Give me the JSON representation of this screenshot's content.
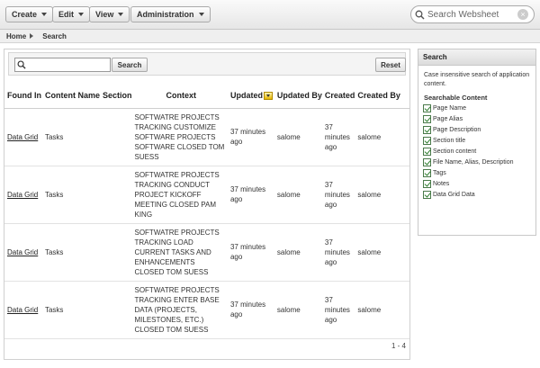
{
  "toolbar": {
    "menus": [
      "Create",
      "Edit",
      "View",
      "Administration"
    ],
    "search_placeholder": "Search Websheet"
  },
  "breadcrumb": {
    "home": "Home",
    "current": "Search"
  },
  "search": {
    "value": "",
    "search_button": "Search",
    "reset_button": "Reset"
  },
  "table": {
    "headers": {
      "found_in": "Found In",
      "content_name": "Content Name",
      "section": "Section",
      "context": "Context",
      "updated": "Updated",
      "updated_by": "Updated By",
      "created": "Created",
      "created_by": "Created By"
    },
    "rows": [
      {
        "found_in": "Data Grid",
        "content_name": "Tasks",
        "section": "",
        "context": "SOFTWATRE PROJECTS TRACKING CUSTOMIZE SOFTWARE PROJECTS SOFTWARE CLOSED TOM SUESS",
        "updated": "37 minutes ago",
        "updated_by": "salome",
        "created": "37 minutes ago",
        "created_by": "salome"
      },
      {
        "found_in": "Data Grid",
        "content_name": "Tasks",
        "section": "",
        "context": "SOFTWATRE PROJECTS TRACKING CONDUCT PROJECT KICKOFF MEETING CLOSED PAM KING",
        "updated": "37 minutes ago",
        "updated_by": "salome",
        "created": "37 minutes ago",
        "created_by": "salome"
      },
      {
        "found_in": "Data Grid",
        "content_name": "Tasks",
        "section": "",
        "context": "SOFTWATRE PROJECTS TRACKING LOAD CURRENT TASKS AND ENHANCEMENTS CLOSED TOM SUESS",
        "updated": "37 minutes ago",
        "updated_by": "salome",
        "created": "37 minutes ago",
        "created_by": "salome"
      },
      {
        "found_in": "Data Grid",
        "content_name": "Tasks",
        "section": "",
        "context": "SOFTWATRE PROJECTS TRACKING ENTER BASE DATA (PROJECTS, MILESTONES, ETC.) CLOSED TOM SUESS",
        "updated": "37 minutes ago",
        "updated_by": "salome",
        "created": "37 minutes ago",
        "created_by": "salome"
      }
    ],
    "pagination": "1 - 4"
  },
  "side_panel": {
    "title": "Search",
    "description": "Case insensitive search of application content.",
    "subtitle": "Searchable Content",
    "options": [
      {
        "label": "Page Name",
        "checked": true
      },
      {
        "label": "Page Alias",
        "checked": true
      },
      {
        "label": "Page Description",
        "checked": true
      },
      {
        "label": "Section title",
        "checked": true
      },
      {
        "label": "Section content",
        "checked": true
      },
      {
        "label": "File Name, Alias, Description",
        "checked": true
      },
      {
        "label": "Tags",
        "checked": true
      },
      {
        "label": "Notes",
        "checked": true
      },
      {
        "label": "Data Grid Data",
        "checked": true
      }
    ]
  },
  "icons": {
    "search": "magnifier-icon",
    "clear": "clear-icon",
    "sort": "sort-desc-icon",
    "checkbox": "checkbox-checked-icon"
  }
}
